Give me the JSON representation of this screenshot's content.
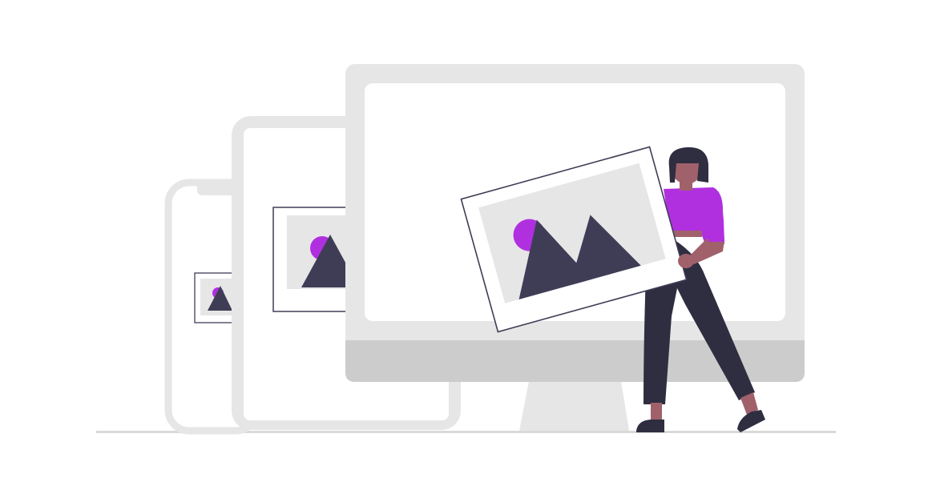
{
  "illustration": {
    "colors": {
      "background": "#ffffff",
      "device_frame_light": "#e6e6e6",
      "device_frame_mid": "#cccccc",
      "screen": "#ffffff",
      "photo_border": "#3f3d56",
      "photo_bg": "#e6e6e6",
      "mountain": "#3f3d56",
      "sun": "#b030e0",
      "shirt": "#b030e0",
      "skin": "#a0616a",
      "hair": "#2f2e41",
      "pants": "#2f2e41",
      "ground": "#cccccc"
    },
    "icons": [
      "phone-icon",
      "tablet-icon",
      "desktop-monitor-icon",
      "image-placeholder-icon",
      "person-figure"
    ]
  }
}
